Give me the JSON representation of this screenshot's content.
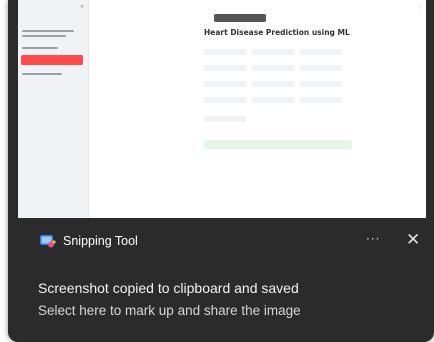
{
  "notification": {
    "app_name": "Snipping Tool",
    "more_label": "···",
    "close_label": "✕",
    "message_title": "Screenshot copied to clipboard and saved",
    "message_body": "Select here to mark up and share the image"
  },
  "preview": {
    "title": "Heart Disease Prediction using ML"
  },
  "colors": {
    "toast_bg": "#2b2b2b",
    "accent_red": "#ff4b4b",
    "success_bg": "#e5f5ea"
  },
  "icons": {
    "app_icon": "snipping-tool-icon",
    "close": "close-icon",
    "more": "more-options-icon"
  }
}
